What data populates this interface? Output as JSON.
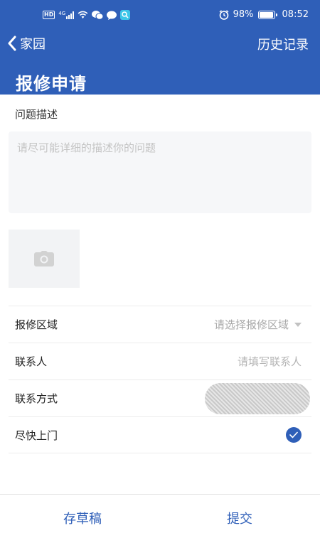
{
  "status_bar": {
    "left_icons": [
      "hd-icon",
      "signal-icon",
      "wifi-icon",
      "wechat-icon",
      "chat-icon",
      "search-app-icon"
    ],
    "hd_text": "HD",
    "network_text": "4G",
    "battery_percent": "98%",
    "battery_level": 0.98,
    "time": "08:52"
  },
  "nav": {
    "back_label": "家园",
    "history_label": "历史记录"
  },
  "page_title": "报修申请",
  "form": {
    "description_label": "问题描述",
    "description_placeholder": "请尽可能详细的描述你的问题",
    "photo_icon": "camera-icon",
    "area_label": "报修区域",
    "area_placeholder": "请选择报修区域",
    "contact_label": "联系人",
    "contact_placeholder": "请填写联系人",
    "phone_label": "联系方式",
    "urgent_label": "尽快上门",
    "urgent_checked": true
  },
  "bottom": {
    "draft_label": "存草稿",
    "submit_label": "提交"
  },
  "colors": {
    "primary": "#2f5fb8",
    "input_bg": "#f6f7f9",
    "placeholder": "#c4c4c4"
  }
}
